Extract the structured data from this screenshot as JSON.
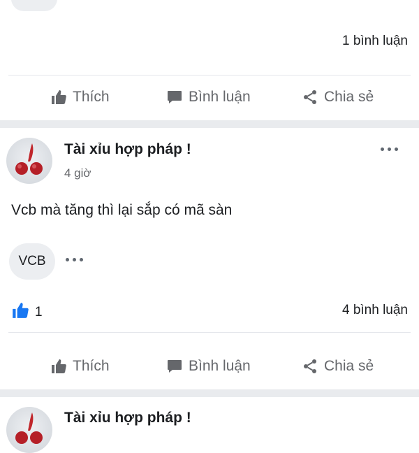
{
  "top_post": {
    "comment_count": "1 bình luận",
    "actions": {
      "like": "Thích",
      "comment": "Bình luận",
      "share": "Chia sẻ"
    }
  },
  "post": {
    "author": "Tài xỉu hợp pháp !",
    "time": "4 giờ",
    "text": "Vcb mà tăng thì lại sắp có mã sàn",
    "tag": "VCB",
    "like_count": "1",
    "comment_count": "4 bình luận",
    "actions": {
      "like": "Thích",
      "comment": "Bình luận",
      "share": "Chia sẻ"
    }
  },
  "next_post": {
    "author": "Tài xỉu hợp pháp !"
  },
  "colors": {
    "like_blue": "#1877f2",
    "action_grey": "#65676b",
    "separator": "#e9ebee"
  },
  "icons": [
    "thumbs-up-icon",
    "comment-bubble-icon",
    "share-icon",
    "more-dots-icon"
  ]
}
